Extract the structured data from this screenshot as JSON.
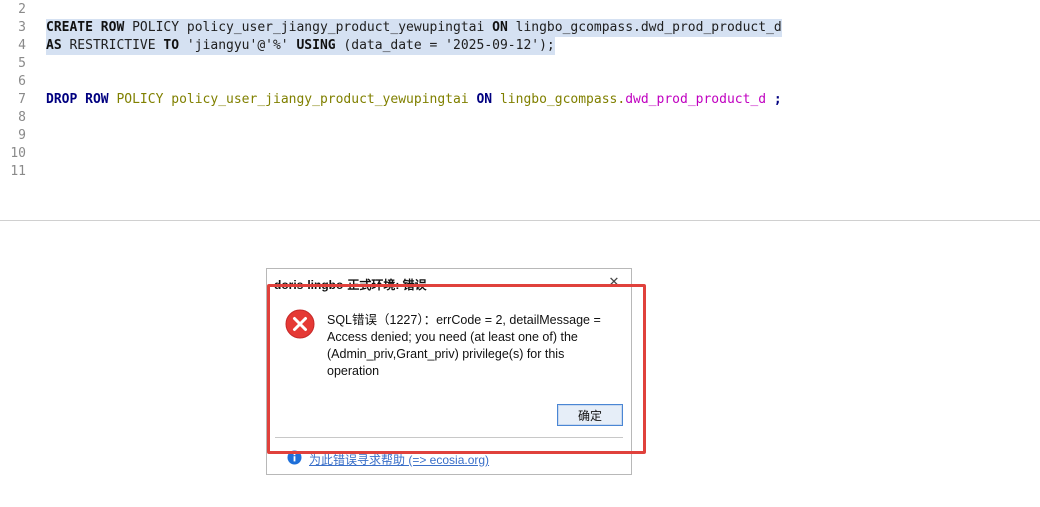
{
  "editor": {
    "lines": [
      {
        "num": "2",
        "segments": []
      },
      {
        "num": "3",
        "selected": true,
        "segments": [
          {
            "t": "CREATE",
            "c": "kw2"
          },
          {
            "t": " ",
            "c": "plain"
          },
          {
            "t": "ROW",
            "c": "kw2"
          },
          {
            "t": " POLICY policy_user_jiangy_product_yewupingtai ",
            "c": "plain"
          },
          {
            "t": "ON",
            "c": "kw2"
          },
          {
            "t": " lingbo_gcompass.dwd_prod_product_d",
            "c": "plain"
          }
        ]
      },
      {
        "num": "4",
        "selected": true,
        "segments": [
          {
            "t": "AS",
            "c": "kw2"
          },
          {
            "t": " RESTRICTIVE ",
            "c": "plain"
          },
          {
            "t": "TO",
            "c": "kw2"
          },
          {
            "t": " 'jiangyu'@'%' ",
            "c": "plain"
          },
          {
            "t": "USING",
            "c": "kw2"
          },
          {
            "t": " (data_date = '2025-09-12');",
            "c": "plain"
          }
        ]
      },
      {
        "num": "5",
        "segments": []
      },
      {
        "num": "6",
        "segments": []
      },
      {
        "num": "7",
        "segments": [
          {
            "t": "DROP",
            "c": "kw"
          },
          {
            "t": " ",
            "c": "plain"
          },
          {
            "t": "ROW",
            "c": "kw"
          },
          {
            "t": " ",
            "c": "plain"
          },
          {
            "t": "POLICY policy_user_jiangy_product_yewupingtai",
            "c": "ident"
          },
          {
            "t": " ",
            "c": "plain"
          },
          {
            "t": "ON",
            "c": "kw"
          },
          {
            "t": " ",
            "c": "plain"
          },
          {
            "t": "lingbo_gcompass.",
            "c": "ident"
          },
          {
            "t": "dwd_prod_product_d",
            "c": "tbl"
          },
          {
            "t": " ;",
            "c": "kw"
          }
        ]
      },
      {
        "num": "8",
        "segments": []
      },
      {
        "num": "9",
        "segments": []
      },
      {
        "num": "10",
        "segments": []
      },
      {
        "num": "11",
        "segments": []
      }
    ]
  },
  "dialog": {
    "title": "doris-lingbo-正式环境: 错误",
    "close_glyph": "✕",
    "message": "SQL错误（1227）：errCode = 2, detailMessage = Access denied; you need (at least one of) the (Admin_priv,Grant_priv) privilege(s) for this operation",
    "ok_label": "确定",
    "help_link": "为此错误寻求帮助 (=> ecosia.org)",
    "icons": {
      "error": "error-icon",
      "info": "info-icon"
    }
  },
  "colors": {
    "highlight": "#e0413c",
    "error_red": "#e53935",
    "info_blue": "#1e6fd9",
    "selection": "#d5e1f2"
  }
}
